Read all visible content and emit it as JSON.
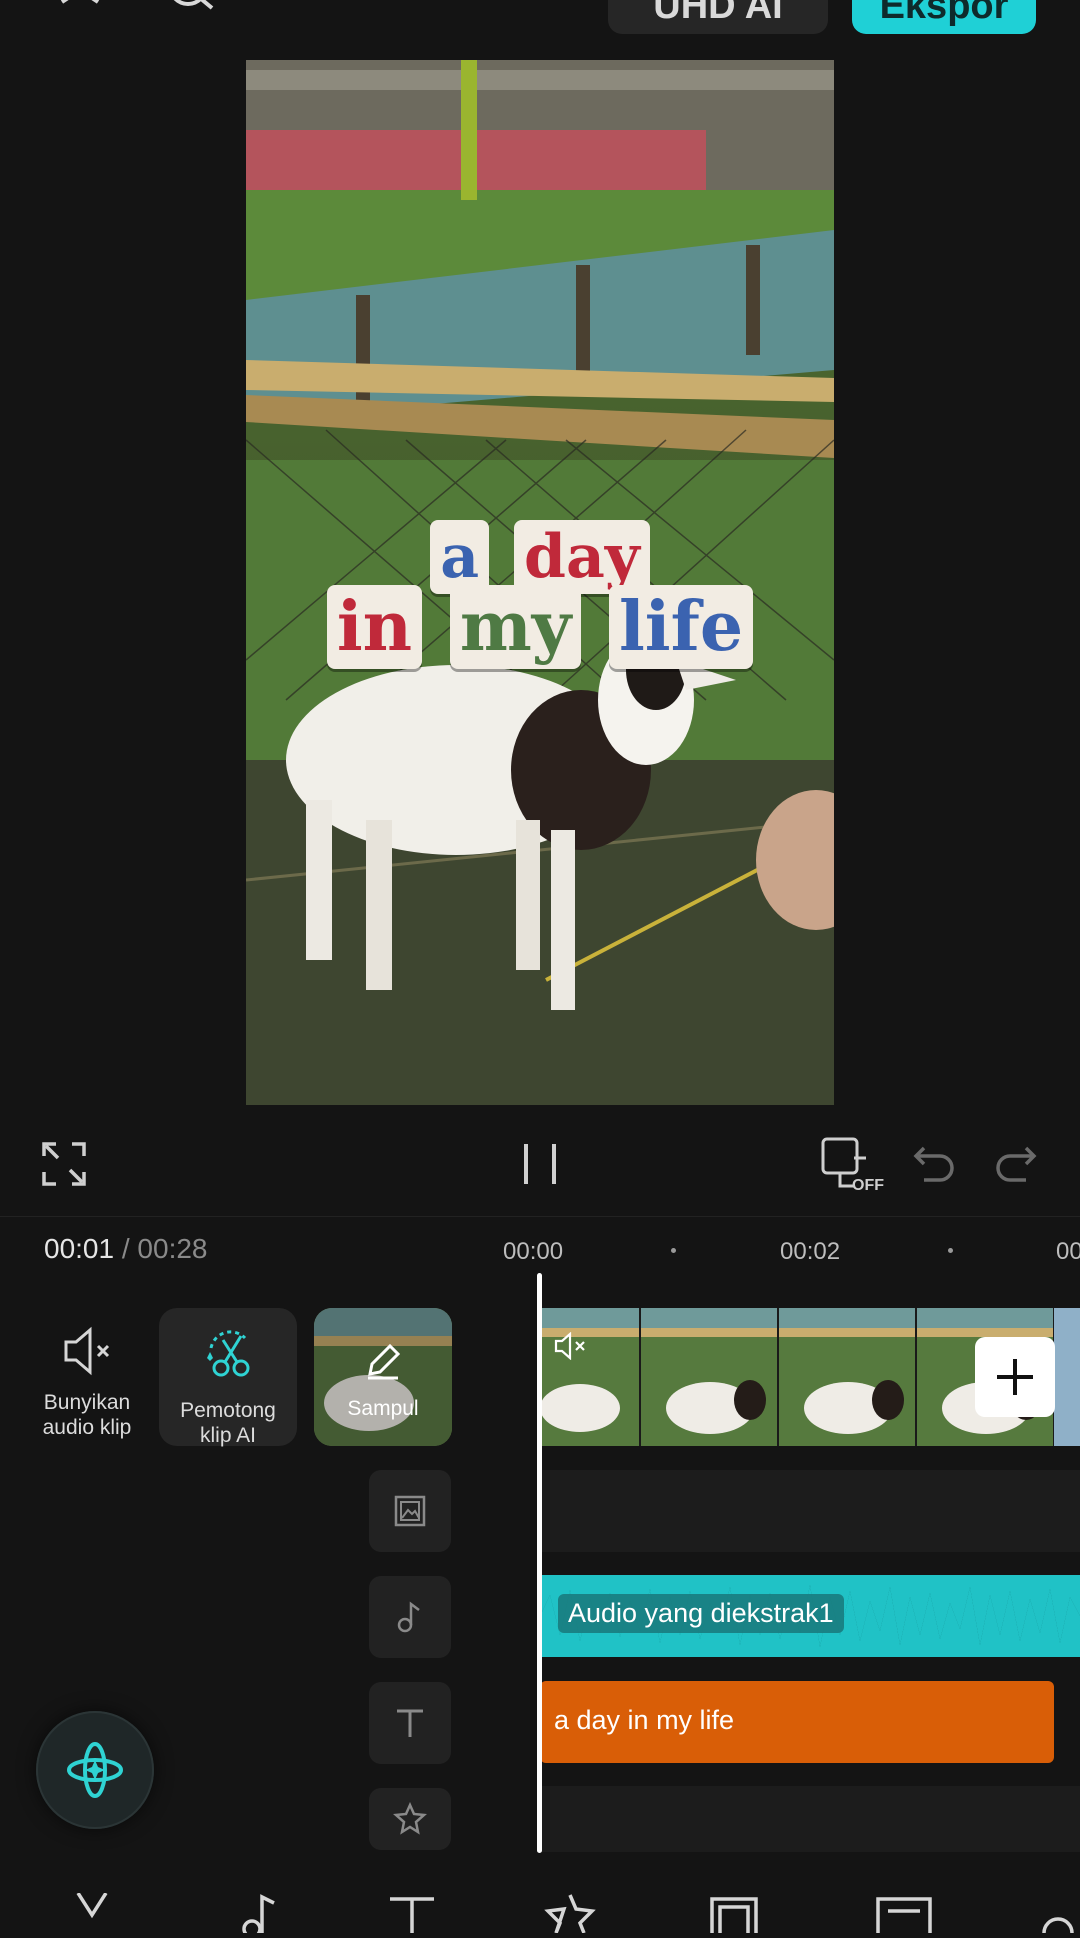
{
  "top_bar": {
    "buttons": [
      "UHD AI",
      "Ekspor"
    ]
  },
  "preview": {
    "title_line1": [
      "a",
      "day"
    ],
    "title_line2": [
      "in",
      "my",
      "life"
    ]
  },
  "timeline": {
    "current": "00:01",
    "separator": "/",
    "total": "00:28",
    "ruler": [
      "00:00",
      "00:02",
      "00"
    ]
  },
  "tools": [
    {
      "label_line1": "Bunyikan",
      "label_line2": "audio klip",
      "icon": "speaker-mute-icon"
    },
    {
      "label_line1": "Pemotong",
      "label_line2": "klip AI",
      "icon": "ai-scissors-icon"
    },
    {
      "label_line1": "Sampul",
      "icon": "pencil-icon"
    }
  ],
  "tracks": {
    "audio_label": "Audio yang diekstrak1",
    "text_label": "a day in my life"
  },
  "colors": {
    "accent": "#1fd0d6",
    "audio_track": "#136e70",
    "text_track": "#d95e07"
  }
}
